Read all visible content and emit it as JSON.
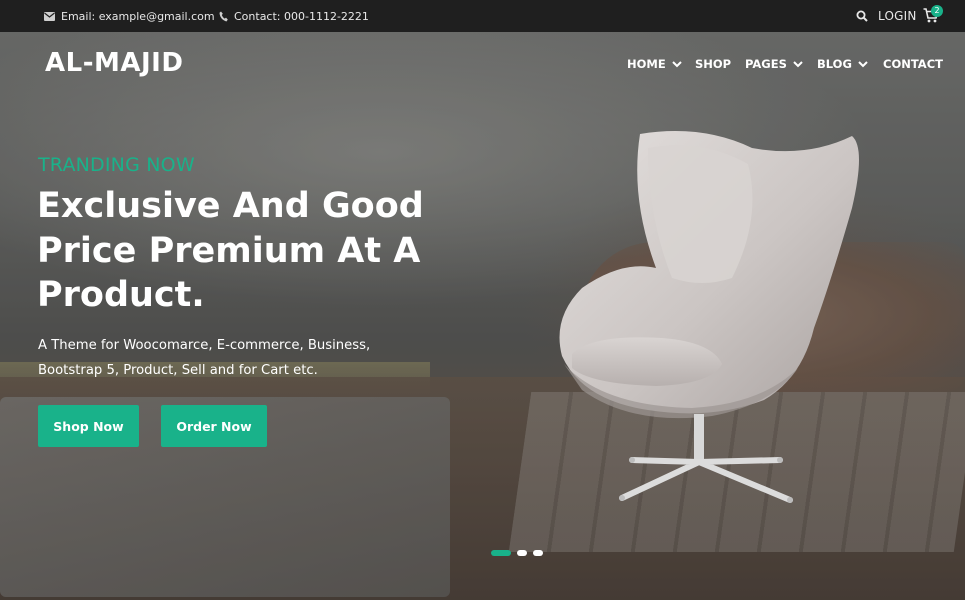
{
  "topbar": {
    "email": "Email: example@gmail.com",
    "phone": "Contact: 000-1112-2221",
    "login": "LOGIN",
    "cart_count": "2",
    "icons": {
      "email": "envelope-icon",
      "phone": "phone-icon",
      "search": "search-icon",
      "cart": "cart-icon"
    }
  },
  "header": {
    "logo": "AL-MAJID",
    "nav": [
      {
        "label": "HOME",
        "has_dropdown": true
      },
      {
        "label": "SHOP",
        "has_dropdown": false
      },
      {
        "label": "PAGES",
        "has_dropdown": true
      },
      {
        "label": "BLOG",
        "has_dropdown": true
      },
      {
        "label": "CONTACT",
        "has_dropdown": false
      }
    ]
  },
  "hero": {
    "subtitle": "TRANDING NOW",
    "headline": "Exclusive And Good Price Premium At A Product.",
    "description": "A Theme for Woocomarce, E-commerce, Business, Bootstrap 5, Product, Sell and for Cart etc.",
    "buttons": {
      "shop": "Shop Now",
      "order": "Order Now"
    },
    "slides": {
      "count": 3,
      "active": 1
    }
  },
  "colors": {
    "accent": "#19b28a",
    "topbar_bg": "#1f1f1f",
    "text_light": "#ffffff"
  }
}
